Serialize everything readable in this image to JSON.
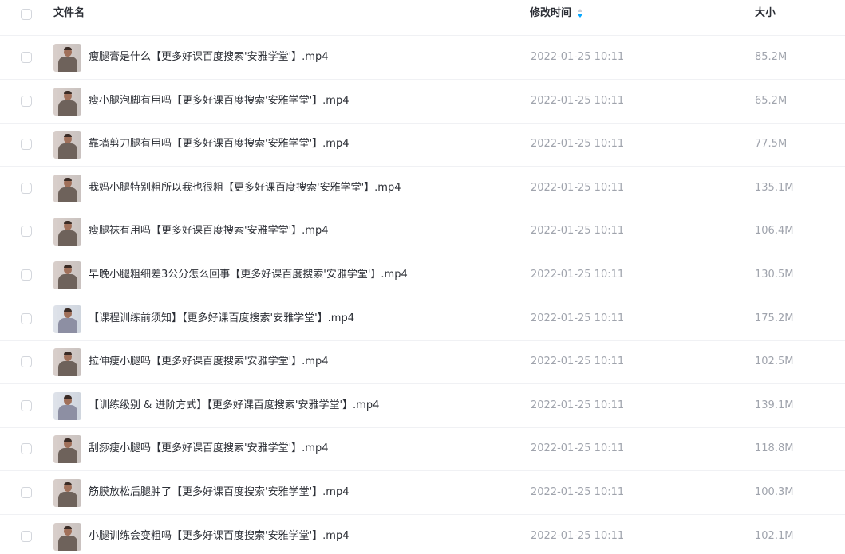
{
  "header": {
    "name": "文件名",
    "time": "修改时间",
    "size": "大小"
  },
  "colors": {
    "accent": "#06a7ff",
    "text": "#2c2f36",
    "muted": "#a0a4ad",
    "divider": "#f0f1f4"
  },
  "files": [
    {
      "name": "瘦腿膏是什么【更多好课百度搜索'安雅学堂'】.mp4",
      "time": "2022-01-25 10:11",
      "size": "85.2M"
    },
    {
      "name": "瘦小腿泡脚有用吗【更多好课百度搜索'安雅学堂'】.mp4",
      "time": "2022-01-25 10:11",
      "size": "65.2M"
    },
    {
      "name": "靠墙剪刀腿有用吗【更多好课百度搜索'安雅学堂'】.mp4",
      "time": "2022-01-25 10:11",
      "size": "77.5M"
    },
    {
      "name": "我妈小腿特别粗所以我也很粗【更多好课百度搜索'安雅学堂'】.mp4",
      "time": "2022-01-25 10:11",
      "size": "135.1M"
    },
    {
      "name": "瘦腿袜有用吗【更多好课百度搜索'安雅学堂'】.mp4",
      "time": "2022-01-25 10:11",
      "size": "106.4M"
    },
    {
      "name": "早晚小腿粗细差3公分怎么回事【更多好课百度搜索'安雅学堂'】.mp4",
      "time": "2022-01-25 10:11",
      "size": "130.5M"
    },
    {
      "name": "【课程训练前须知】【更多好课百度搜索'安雅学堂'】.mp4",
      "time": "2022-01-25 10:11",
      "size": "175.2M"
    },
    {
      "name": "拉伸瘦小腿吗【更多好课百度搜索'安雅学堂'】.mp4",
      "time": "2022-01-25 10:11",
      "size": "102.5M"
    },
    {
      "name": "【训练级别 & 进阶方式】【更多好课百度搜索'安雅学堂'】.mp4",
      "time": "2022-01-25 10:11",
      "size": "139.1M"
    },
    {
      "name": "刮痧瘦小腿吗【更多好课百度搜索'安雅学堂'】.mp4",
      "time": "2022-01-25 10:11",
      "size": "118.8M"
    },
    {
      "name": "筋膜放松后腿肿了【更多好课百度搜索'安雅学堂'】.mp4",
      "time": "2022-01-25 10:11",
      "size": "100.3M"
    },
    {
      "name": "小腿训练会变粗吗【更多好课百度搜索'安雅学堂'】.mp4",
      "time": "2022-01-25 10:11",
      "size": "102.1M"
    }
  ]
}
